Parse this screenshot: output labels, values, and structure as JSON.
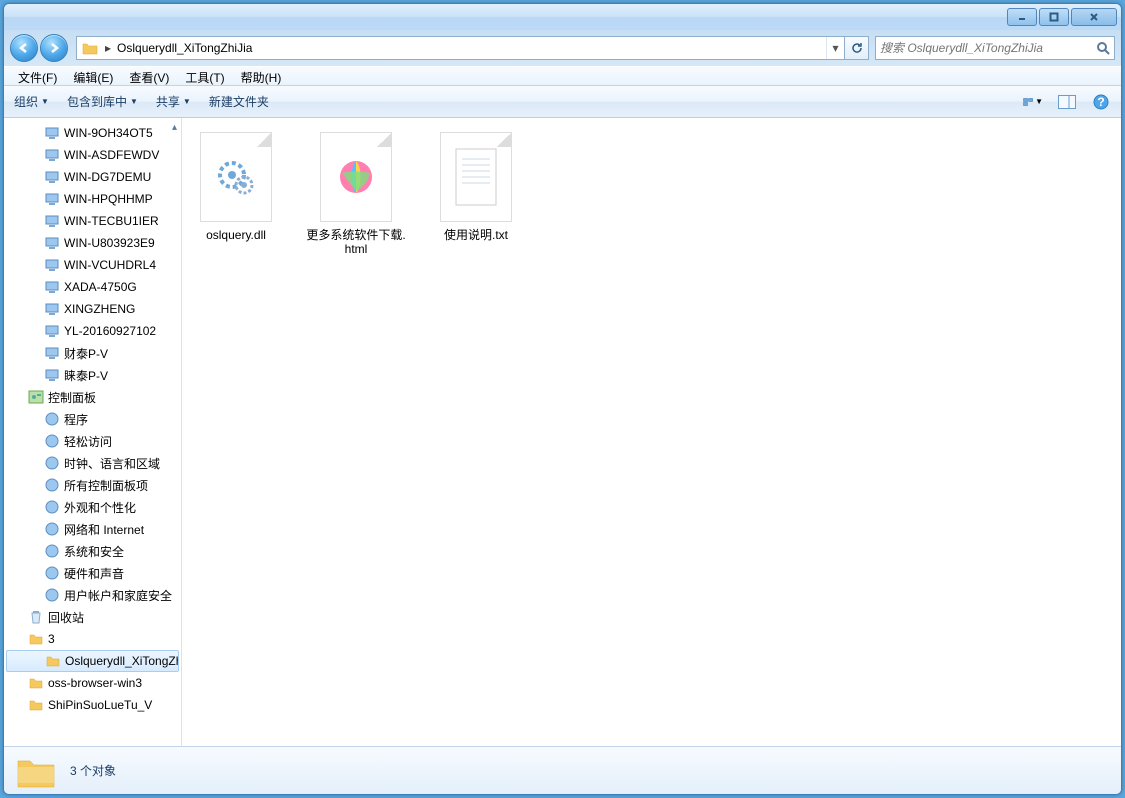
{
  "window": {
    "breadcrumb_root": "Oslquerydll_XiTongZhiJia"
  },
  "search": {
    "placeholder": "搜索 Oslquerydll_XiTongZhiJia"
  },
  "menu": {
    "file": "文件(F)",
    "edit": "编辑(E)",
    "view": "查看(V)",
    "tools": "工具(T)",
    "help": "帮助(H)"
  },
  "toolbar": {
    "organize": "组织",
    "include": "包含到库中",
    "share": "共享",
    "newfolder": "新建文件夹"
  },
  "sidebar": {
    "computers": [
      "WIN-9OH34OT5",
      "WIN-ASDFEWDV",
      "WIN-DG7DEMU",
      "WIN-HPQHHMP",
      "WIN-TECBU1IER",
      "WIN-U803923E9",
      "WIN-VCUHDRL4",
      "XADA-4750G",
      "XINGZHENG",
      "YL-20160927102",
      "财泰P-V",
      "睐泰P-V"
    ],
    "cp": {
      "root": "控制面板",
      "items": [
        "程序",
        "轻松访问",
        "时钟、语言和区域",
        "所有控制面板项",
        "外观和个性化",
        "网络和 Internet",
        "系统和安全",
        "硬件和声音",
        "用户帐户和家庭安全"
      ]
    },
    "recycle": "回收站",
    "folders": [
      "3",
      "Oslquerydll_XiTongZhiJia",
      "oss-browser-win3",
      "ShiPinSuoLueTu_V"
    ],
    "selected_index": 1
  },
  "files": [
    {
      "name": "oslquery.dll",
      "icon": "dll"
    },
    {
      "name": "更多系统软件下载.html",
      "icon": "html"
    },
    {
      "name": "使用说明.txt",
      "icon": "txt"
    }
  ],
  "status": {
    "text": "3 个对象"
  }
}
